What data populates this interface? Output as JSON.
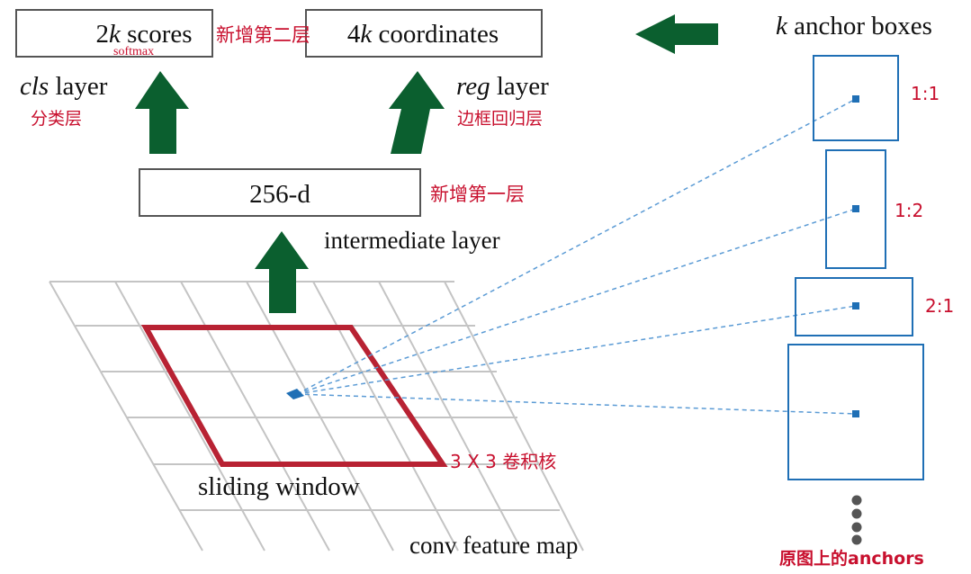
{
  "colors": {
    "arrow_green": "#0b5f2f",
    "window_red": "#b82233",
    "anchor_blue": "#1f6fb5",
    "annotation_red": "#c8102e",
    "grid_gray": "#c4c4c4",
    "box_border": "#555555",
    "text_dark": "#111111"
  },
  "top_boxes": {
    "scores": {
      "prefix": "2",
      "var": "k",
      "suffix": " scores"
    },
    "coordinates": {
      "prefix": "4",
      "var": "k",
      "suffix": " coordinates"
    },
    "softmax_note": "softmax"
  },
  "layers": {
    "cls": {
      "var": "cls",
      "suffix": " layer"
    },
    "reg": {
      "var": "reg",
      "suffix": " layer"
    },
    "intermediate_box": "256-d",
    "intermediate_label": "intermediate layer"
  },
  "annotations": {
    "new_second_layer": "新增第二层",
    "new_first_layer": "新增第一层",
    "classification_layer": "分类层",
    "bbox_regression_layer": "边框回归层",
    "kernel": "3 X 3 卷积核",
    "original_anchors": "原图上的anchors"
  },
  "anchors": {
    "title_var": "k",
    "title_suffix": " anchor boxes",
    "ratios": [
      "1:1",
      "1:2",
      "2:1"
    ]
  },
  "feature_map": {
    "sliding_window_label": "sliding window",
    "map_label": "conv feature map"
  },
  "icons": [
    "up-arrow-icon",
    "left-arrow-icon",
    "ellipsis-dots-icon"
  ]
}
